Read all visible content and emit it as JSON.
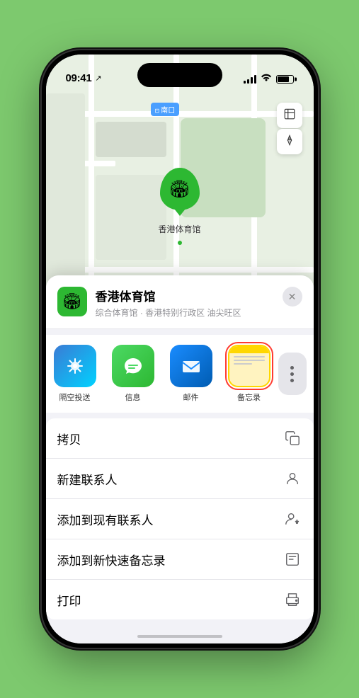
{
  "phone": {
    "status_bar": {
      "time": "09:41",
      "location_arrow": "↗"
    }
  },
  "map": {
    "label": "南口",
    "controls": {
      "map_type_icon": "🗺",
      "location_icon": "➤"
    },
    "marker": {
      "label": "香港体育馆"
    }
  },
  "venue_sheet": {
    "icon": "🏟",
    "name": "香港体育馆",
    "subtitle": "综合体育馆 · 香港特别行政区 油尖旺区",
    "close_label": "✕"
  },
  "share_apps": [
    {
      "id": "airdrop",
      "label": "隔空投送",
      "type": "airdrop"
    },
    {
      "id": "messages",
      "label": "信息",
      "type": "messages"
    },
    {
      "id": "mail",
      "label": "邮件",
      "type": "mail"
    },
    {
      "id": "notes",
      "label": "备忘录",
      "type": "notes",
      "selected": true
    }
  ],
  "actions": [
    {
      "id": "copy",
      "label": "拷贝",
      "icon": "⧉"
    },
    {
      "id": "add-contact",
      "label": "新建联系人",
      "icon": "👤"
    },
    {
      "id": "add-existing",
      "label": "添加到现有联系人",
      "icon": "👤"
    },
    {
      "id": "add-notes",
      "label": "添加到新快速备忘录",
      "icon": "⊡"
    },
    {
      "id": "print",
      "label": "打印",
      "icon": "🖨"
    }
  ]
}
